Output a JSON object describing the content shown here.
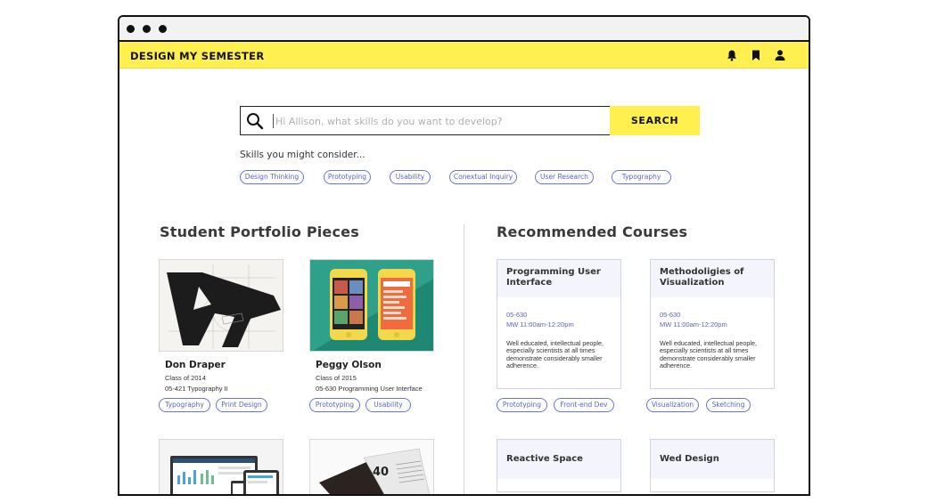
{
  "app": {
    "title": "DESIGN MY SEMESTER"
  },
  "header_icons": [
    "bell-icon",
    "bookmark-icon",
    "user-icon"
  ],
  "search": {
    "placeholder": "Hi Allison, what skills do you want to develop?",
    "button_label": "SEARCH"
  },
  "skills": {
    "title": "Skills you might consider...",
    "items": [
      "Design Thinking",
      "Prototyping",
      "Usability",
      "Conextual Inquiry",
      "User Research",
      "Typography"
    ]
  },
  "portfolio": {
    "title": "Student Portfolio Pieces",
    "items": [
      {
        "name": "Don Draper",
        "class": "Class of 2014",
        "course": "05-421 Typography II",
        "tags": [
          "Typography",
          "Print Design"
        ]
      },
      {
        "name": "Peggy Olson",
        "class": "Class of 2015",
        "course": "05-630 Programming User Interface",
        "tags": [
          "Prototyping",
          "Usability"
        ]
      }
    ]
  },
  "courses": {
    "title": "Recommended Courses",
    "items": [
      {
        "title": "Programming User Interface",
        "code": "05-630",
        "time": "MW 11:00am-12:20pm",
        "desc": "Well educated, intellectual people, especially scientists at all times demonstrate considerably smaller adherence.",
        "tags": [
          "Prototyping",
          "Front-end Dev"
        ]
      },
      {
        "title": "Methodoligies of Visualization",
        "code": "05-630",
        "time": "MW 11:00am-12:20pm",
        "desc": "Well educated, intellectual people, especially scientists at all times demonstrate considerably smaller adherence.",
        "tags": [
          "Visualization",
          "Sketching"
        ]
      },
      {
        "title": "Reactive Space"
      },
      {
        "title": "Wed Design"
      }
    ]
  },
  "colors": {
    "accent": "#fff04f",
    "tag": "#5b63c9",
    "card_head": "#f4f5fc"
  }
}
